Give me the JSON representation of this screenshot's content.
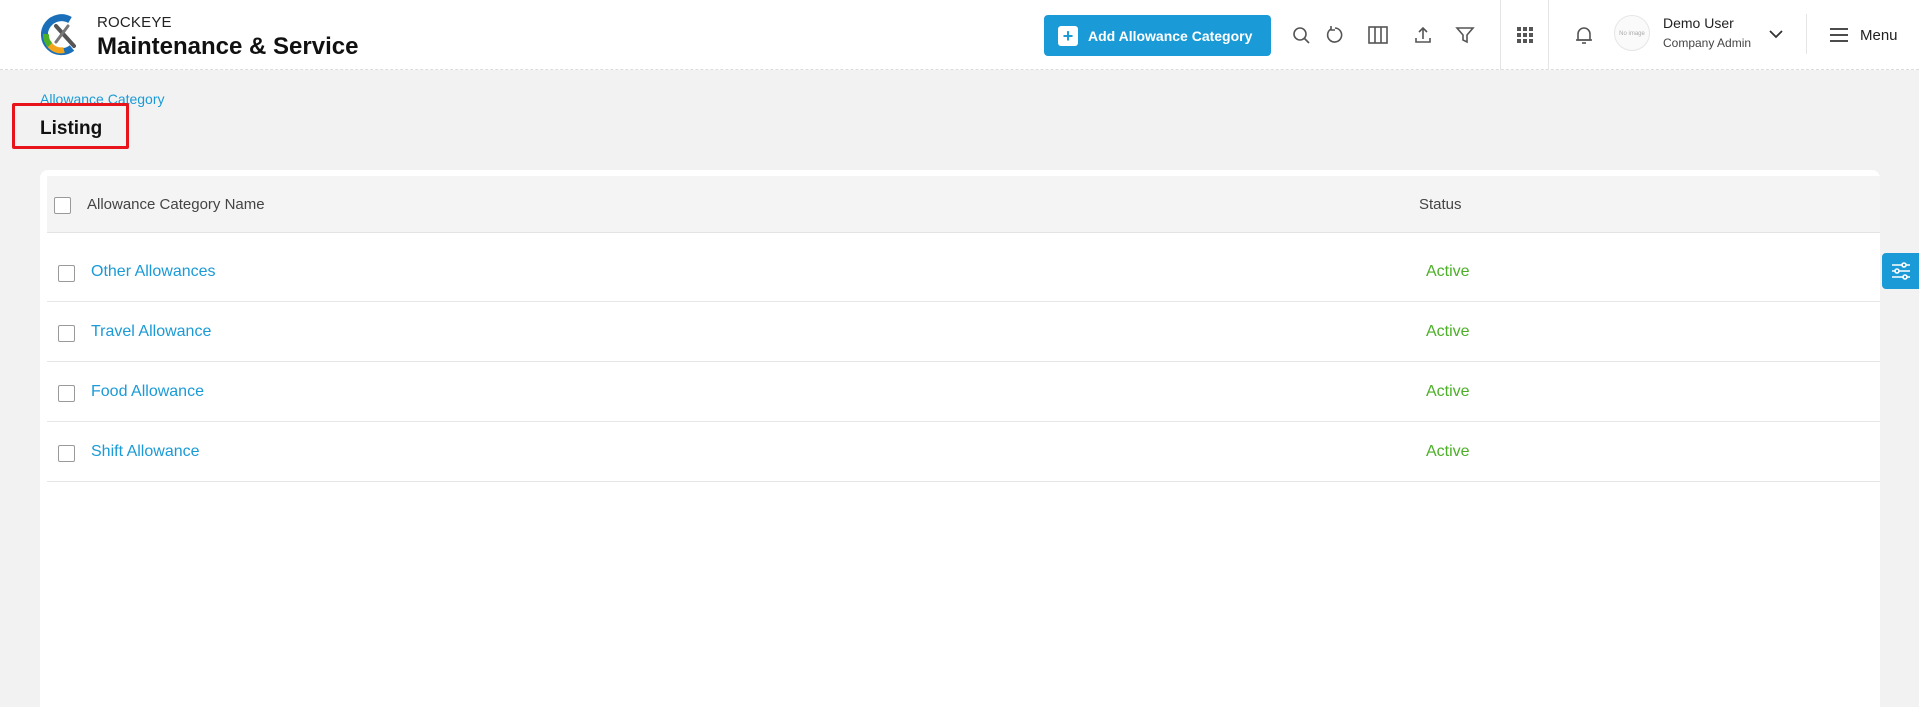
{
  "header": {
    "brand_top": "ROCKEYE",
    "brand_main": "Maintenance & Service",
    "add_button_label": "Add Allowance Category",
    "user_name": "Demo User",
    "user_role": "Company Admin",
    "avatar_text": "No image",
    "menu_label": "Menu"
  },
  "page": {
    "breadcrumb": "Allowance Category",
    "title": "Listing"
  },
  "table": {
    "columns": [
      "Allowance Category Name",
      "Status"
    ],
    "rows": [
      {
        "name": "Other Allowances",
        "status": "Active"
      },
      {
        "name": "Travel Allowance",
        "status": "Active"
      },
      {
        "name": "Food Allowance",
        "status": "Active"
      },
      {
        "name": "Shift Allowance",
        "status": "Active"
      }
    ]
  },
  "colors": {
    "accent": "#1a9ad6",
    "status_active": "#4caf28",
    "highlight": "#e8141b"
  }
}
